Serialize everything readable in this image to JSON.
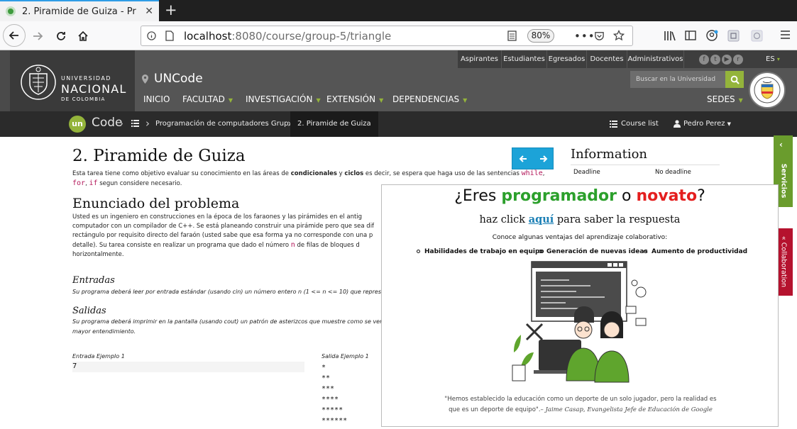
{
  "browser": {
    "tab_title": "2. Piramide de Guiza - Pr",
    "url_host": "localhost",
    "url_path": ":8080/course/group-5/triangle",
    "zoom": "80%"
  },
  "unal": {
    "logo_line1": "UNIVERSIDAD",
    "logo_line2": "NACIONAL",
    "logo_line3": "DE COLOMBIA",
    "top_links": [
      "Aspirantes",
      "Estudiantes",
      "Egresados",
      "Docentes",
      "Administrativos"
    ],
    "social_icons": [
      "facebook-icon",
      "twitter-icon",
      "youtube-icon",
      "rss-icon"
    ],
    "language": "ES",
    "brand": "UNCode",
    "menu": [
      "INICIO",
      "FACULTAD",
      "INVESTIGACIÓN",
      "EXTENSIÓN",
      "DEPENDENCIAS"
    ],
    "search_placeholder": "Buscar en la Universidad",
    "sedes": "SEDES"
  },
  "breadcrumb": {
    "un": "un",
    "code": "Code",
    "course": "Programación de computadores Grup...",
    "task": "2. Piramide de Guiza",
    "course_list": "Course list",
    "user": "Pedro Perez"
  },
  "task": {
    "title": "2. Piramide de Guiza",
    "intro_1": "Esta tarea tiene como objetivo evaluar su conocimiento en las áreas de",
    "intro_b1": "condicionales",
    "intro_and": "y",
    "intro_b2": "ciclos",
    "intro_2": "es decir, se espera que haga uso de las sentencias",
    "kw_while": "while",
    "kw_for": "for",
    "kw_if": "if",
    "intro_3": "segun considere necesario.",
    "statement_title": "Enunciado del problema",
    "statement_lines": [
      "Usted es un ingeniero en construcciones en la época de los faraones y las pirámides en el antig",
      "computador con un compilador de C++. Se está planeando construir una pirámide pero que sea dif",
      "rectángulo por requisito directo del faraón (usted sabe que esa forma ya no corresponde con una p",
      "detalle). Su tarea consiste en realizar un programa que dado el número",
      "horizontalmente."
    ],
    "var_n": "n",
    "statement_tail": "de filas de bloques d",
    "inputs_title": "Entradas",
    "inputs_text": "Su programa deberá leer por entrada estándar (usando cin) un número entero n (1 <= n <= 10) que represe",
    "outputs_title": "Salidas",
    "outputs_line1": "Su programa deberá imprimir en la pantalla (usando cout) un patrón de asterizcos que muestre como se veria",
    "outputs_line2": "mayor entendimiento.",
    "example_in_label": "Entrada Ejemplo 1",
    "example_in": "7",
    "example_out_label": "Salida Ejemplo 1",
    "example_out": [
      "*",
      "**",
      "***",
      "****",
      "*****",
      "******"
    ]
  },
  "info": {
    "title": "Information",
    "deadline_label": "Deadline",
    "deadline_value": "No deadline"
  },
  "popup": {
    "t1": "¿Eres ",
    "t_prog": "programador",
    "t_o": " o ",
    "t_nov": "novato",
    "t_q": "?",
    "sub_pre": "haz click ",
    "sub_link": "aquí",
    "sub_post": " para saber la respuesta",
    "text": "Conoce algunas ventajas del aprendizaje colaborativo:",
    "bullets": [
      "Habilidades de trabajo en equipo",
      "Generación de nuevas ideas",
      "Aumento de productividad"
    ],
    "quote1": "\"Hemos establecido la educación como un deporte de un solo jugador, pero la realidad es",
    "quote2": "que es un deporte de equipo\".–",
    "quote_author": "Jaime Casap, Evangelista Jefe de Educación de Google",
    "prog_color": "#2ca02c",
    "nov_color": "#e41e1e"
  },
  "side_tabs": {
    "servicios": "Servicios",
    "collaboration": "« Collaboration"
  }
}
